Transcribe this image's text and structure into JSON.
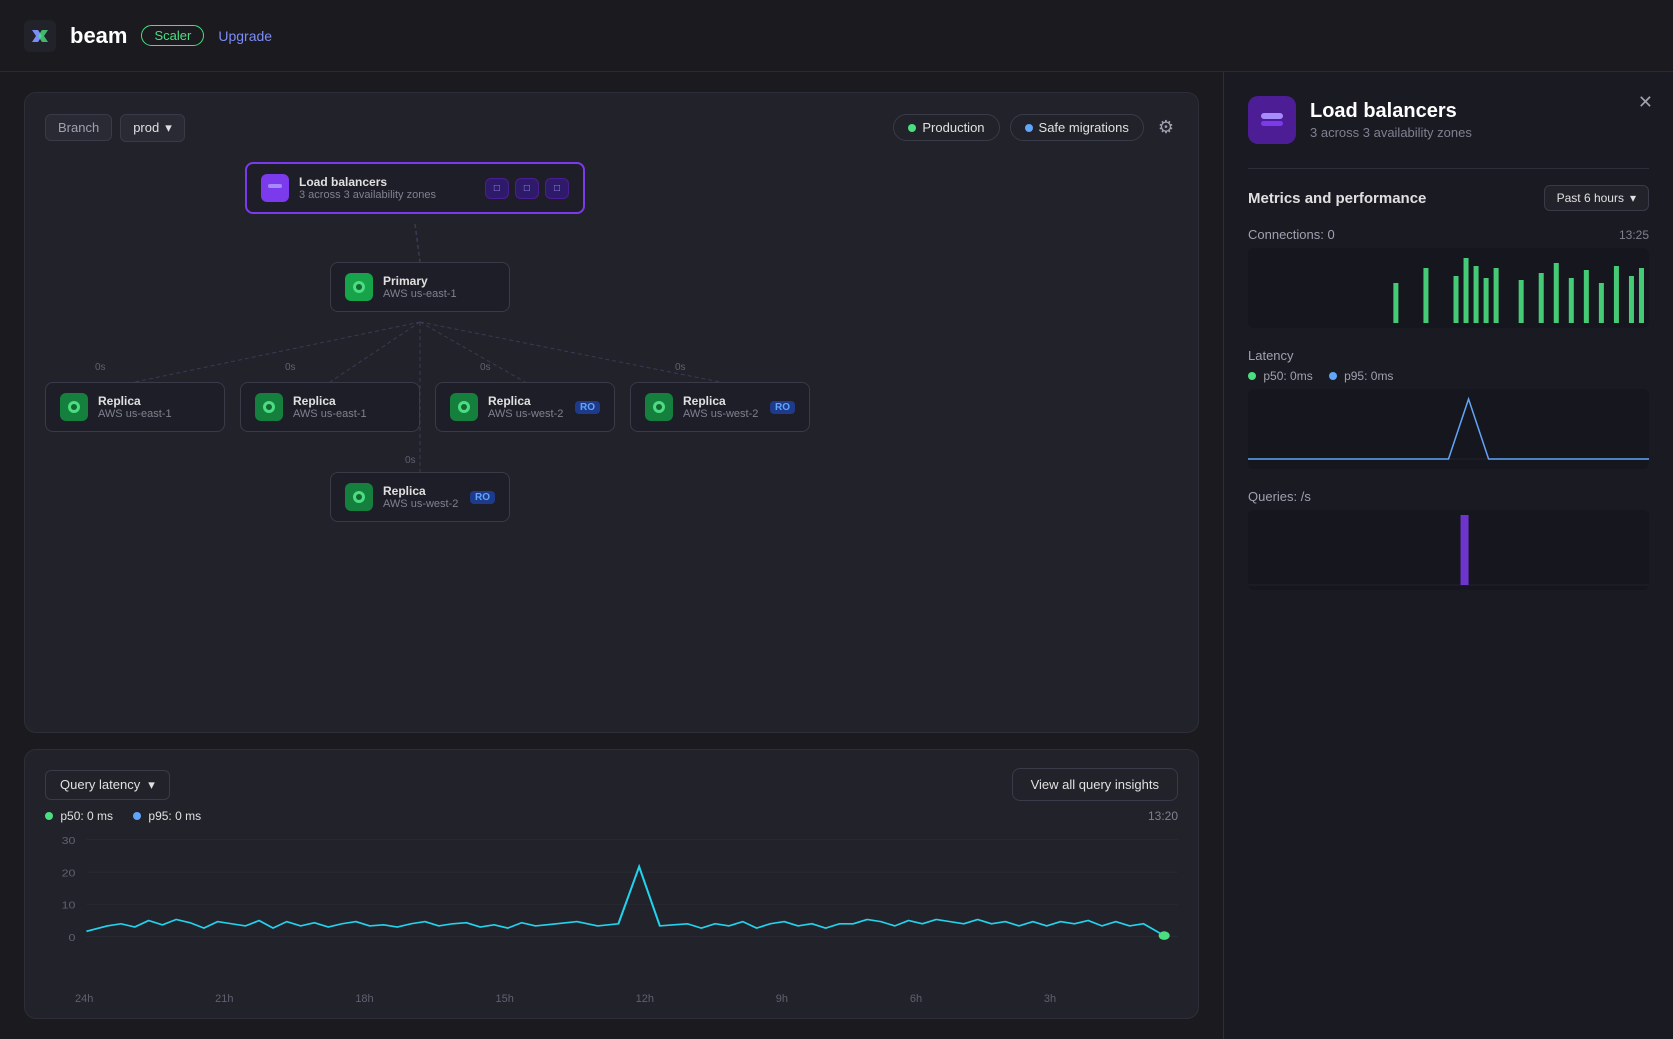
{
  "app": {
    "title": "beam",
    "badge": "Scaler",
    "upgrade_link": "Upgrade"
  },
  "header": {
    "branch_label": "Branch",
    "branch_value": "prod",
    "production_btn": "Production",
    "safe_migrations_btn": "Safe migrations",
    "time_label": "Past 6 hours"
  },
  "topology": {
    "lb_title": "Load balancers",
    "lb_subtitle": "3 across 3 availability zones",
    "lb_instances": [
      "□",
      "□",
      "□"
    ],
    "primary_title": "Primary",
    "primary_region": "AWS us-east-1",
    "replicas": [
      {
        "title": "Replica",
        "region": "AWS us-east-1",
        "ro": false,
        "latency": "0s"
      },
      {
        "title": "Replica",
        "region": "AWS us-east-1",
        "ro": false,
        "latency": "0s"
      },
      {
        "title": "Replica",
        "region": "AWS us-west-2",
        "ro": true,
        "latency": "0s"
      },
      {
        "title": "Replica",
        "region": "AWS us-west-2",
        "ro": true,
        "latency": "0s"
      },
      {
        "title": "Replica",
        "region": "AWS us-west-2",
        "ro": true,
        "latency": "0s"
      }
    ]
  },
  "query_latency": {
    "label": "Query latency",
    "view_insights_btn": "View all query insights",
    "p50_label": "p50:",
    "p50_value": "0 ms",
    "p95_label": "p95:",
    "p95_value": "0 ms",
    "timestamp": "13:20",
    "x_labels": [
      "24h",
      "21h",
      "18h",
      "15h",
      "12h",
      "9h",
      "6h",
      "3h",
      ""
    ],
    "y_labels": [
      "30",
      "20",
      "10",
      "0"
    ]
  },
  "panel": {
    "title": "Load balancers",
    "subtitle": "3 across 3 availability zones",
    "metrics_title": "Metrics and performance",
    "time_dropdown": "Past 6 hours",
    "connections_label": "Connections: 0",
    "connections_time": "13:25",
    "latency_label": "Latency",
    "p50_label": "p50:",
    "p50_value": "0ms",
    "p95_label": "p95:",
    "p95_value": "0ms",
    "queries_label": "Queries: /s"
  },
  "colors": {
    "green": "#4ade80",
    "blue": "#60a5fa",
    "purple": "#a78bfa",
    "cyan": "#22d3ee",
    "violet": "#7c3aed",
    "accent": "#7c8cf8"
  }
}
